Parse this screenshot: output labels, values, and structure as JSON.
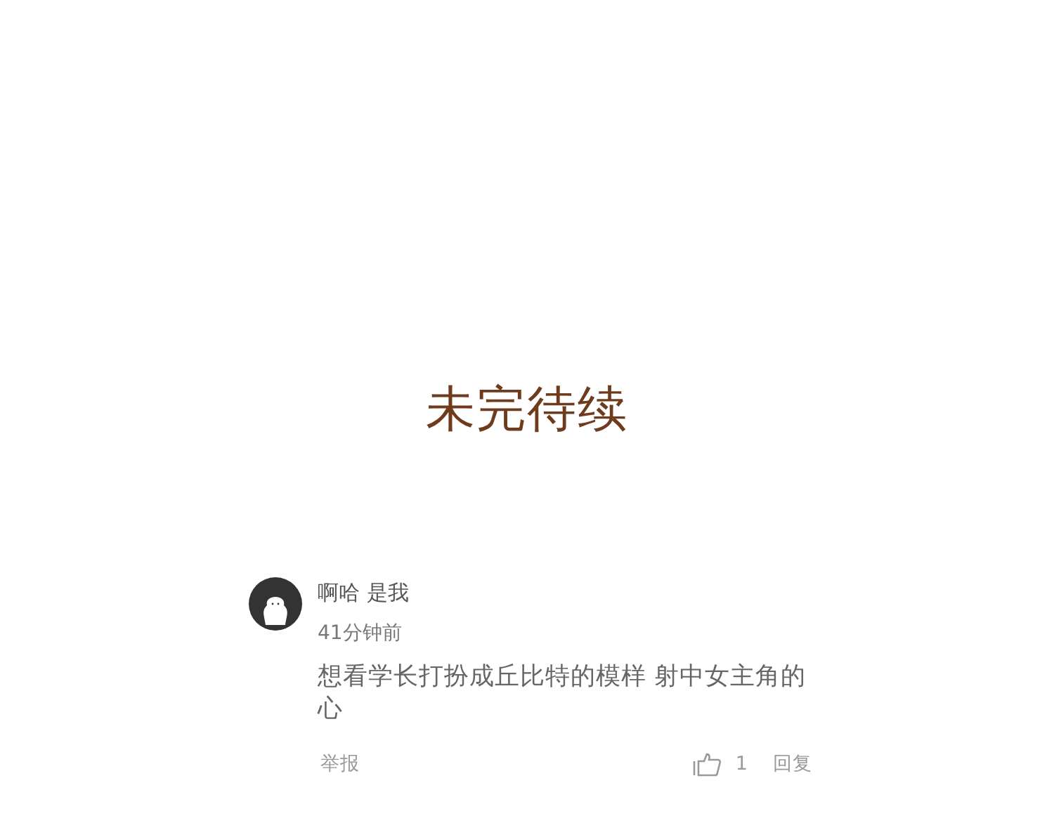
{
  "banner": {
    "text": "未完待续"
  },
  "comments": [
    {
      "author": "啊哈 是我",
      "time": "41分钟前",
      "body": "想看学长打扮成丘比特的模样 射中女主角的心",
      "report": "举报",
      "likes": "1",
      "reply": "回复"
    }
  ]
}
